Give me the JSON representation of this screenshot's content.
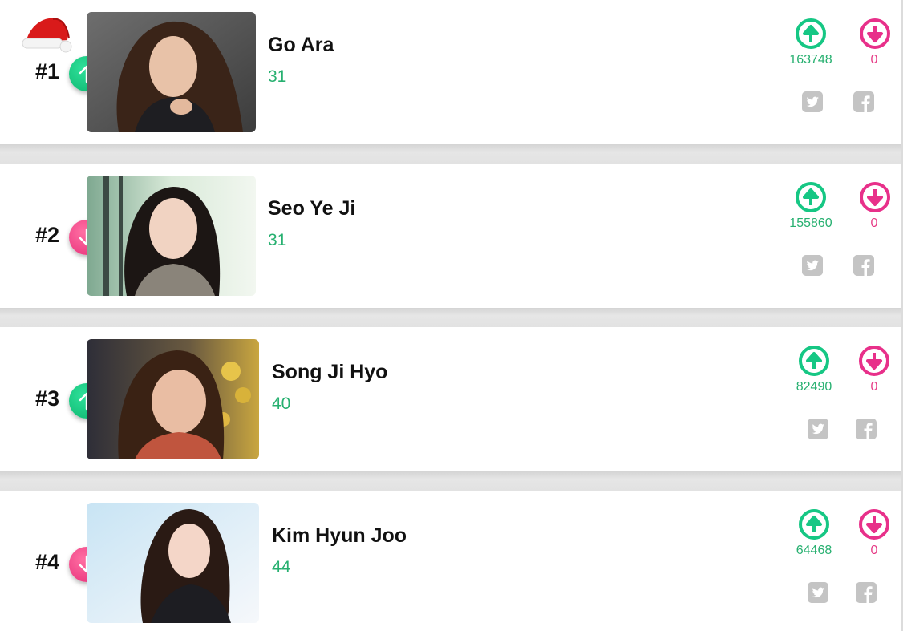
{
  "ranking": [
    {
      "rank": "#1",
      "name": "Go Ara",
      "age": "31",
      "upvotes": "163748",
      "downvotes": "0",
      "trend": "up"
    },
    {
      "rank": "#2",
      "name": "Seo Ye Ji",
      "age": "31",
      "upvotes": "155860",
      "downvotes": "0",
      "trend": "down"
    },
    {
      "rank": "#3",
      "name": "Song Ji Hyo",
      "age": "40",
      "upvotes": "82490",
      "downvotes": "0",
      "trend": "up"
    },
    {
      "rank": "#4",
      "name": "Kim Hyun Joo",
      "age": "44",
      "upvotes": "64468",
      "downvotes": "0",
      "trend": "down"
    }
  ],
  "colors": {
    "up": "#16c784",
    "down": "#e8308a",
    "share": "#c4c4c4"
  },
  "icons": {
    "vote_up": "arrow-circle-up-icon",
    "vote_down": "arrow-circle-down-icon",
    "share_twitter": "twitter-icon",
    "share_facebook": "facebook-icon",
    "decoration": "santa-hat-icon"
  }
}
